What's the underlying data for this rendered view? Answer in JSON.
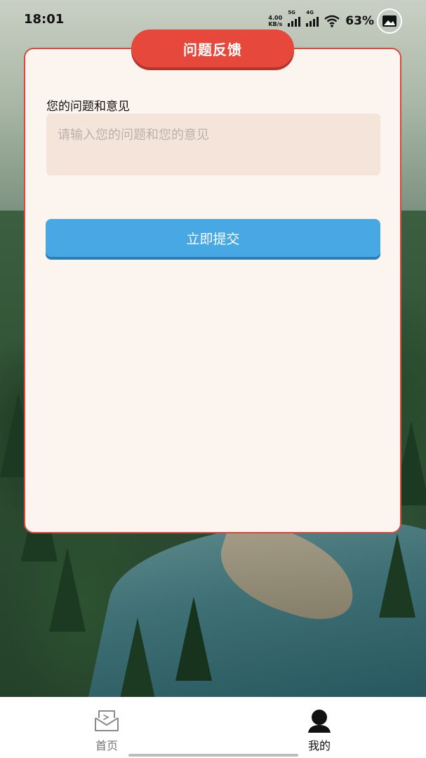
{
  "status_bar": {
    "time": "18:01",
    "net_speed_value": "4.00",
    "net_speed_unit": "KB/s",
    "signal1_label": "5G",
    "signal2_label": "4G",
    "battery": "63%"
  },
  "card": {
    "title": "问题反馈",
    "field_label": "您的问题和意见",
    "input_placeholder": "请输入您的问题和您的意见",
    "input_value": "",
    "submit_label": "立即提交"
  },
  "bottom_nav": {
    "items": [
      {
        "label": "首页",
        "icon": "home-inbox-icon",
        "active": false
      },
      {
        "label": "我的",
        "icon": "person-icon",
        "active": true
      }
    ]
  },
  "colors": {
    "title_pill": "#e6483b",
    "card_border": "#d34a3f",
    "card_bg": "#fcf4ef",
    "input_bg": "#f5e4d9",
    "submit_button": "#48a8e3"
  }
}
